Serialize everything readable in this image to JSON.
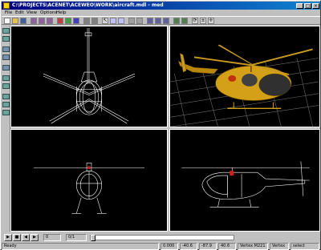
{
  "window": {
    "title": "C:\\PROJECTS\\ACENET\\ACEWEO\\WORK\\aircraft.mdl - med",
    "minimize": "_",
    "maximize": "□",
    "close": "×"
  },
  "menu": [
    "File",
    "Edit",
    "View",
    "Options",
    "Help"
  ],
  "playbar": {
    "frame": "0",
    "frame_total": "0/1"
  },
  "statusbar": {
    "ready": "Ready",
    "coords": [
      "0.000",
      "-40.6",
      "-87.9",
      "40.6"
    ],
    "vertex_count": "Vertex M221",
    "mode": "Vertex",
    "selection": "select"
  },
  "colors": {
    "title_start": "#000080",
    "title_end": "#1084d0",
    "wireframe": "#ffffff",
    "aircraft_body": "#d4a017",
    "viewport_bg": "#000000",
    "grid": "#808080"
  },
  "viewports": [
    "top-view",
    "perspective-view",
    "front-view",
    "side-view"
  ]
}
